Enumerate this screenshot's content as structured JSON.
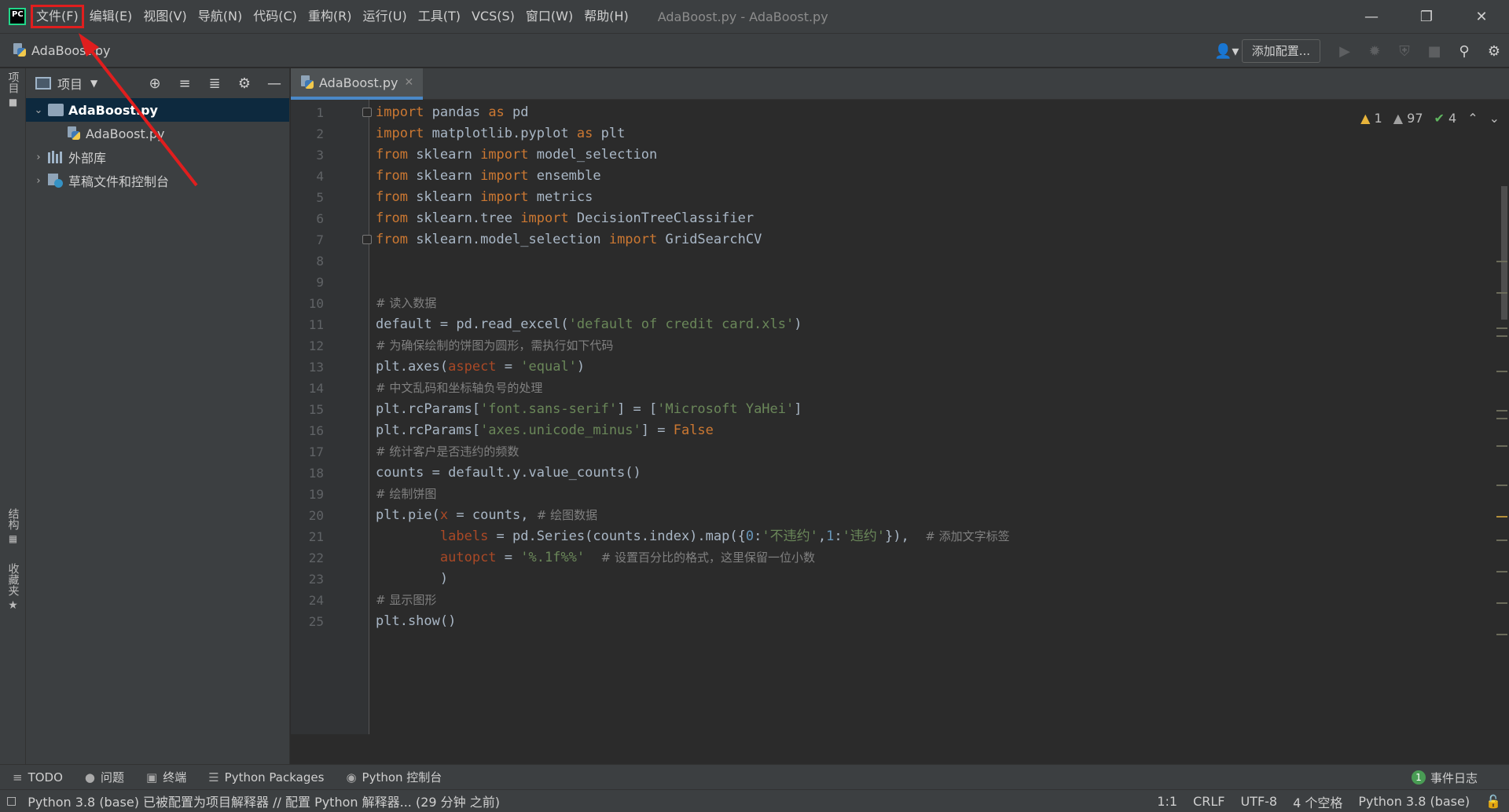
{
  "menu": {
    "items": [
      "文件(F)",
      "编辑(E)",
      "视图(V)",
      "导航(N)",
      "代码(C)",
      "重构(R)",
      "运行(U)",
      "工具(T)",
      "VCS(S)",
      "窗口(W)",
      "帮助(H)"
    ],
    "highlighted_index": 0
  },
  "window": {
    "title": "AdaBoost.py - AdaBoost.py"
  },
  "navbar": {
    "file_label": "AdaBoost.py",
    "run_config_label": "添加配置..."
  },
  "left_strip": {
    "project_label": "项目",
    "structure_label": "结构",
    "favorites_label": "收藏夹"
  },
  "project_panel": {
    "title": "项目",
    "tree": {
      "root_label": "AdaBoost.py",
      "child_label": "AdaBoost.py",
      "external_libs_label": "外部库",
      "scratches_label": "草稿文件和控制台"
    }
  },
  "editor": {
    "tab_label": "AdaBoost.py",
    "inspections": {
      "warnings": "1",
      "weak_warnings": "97",
      "typos": "4"
    },
    "line_numbers": [
      "1",
      "2",
      "3",
      "4",
      "5",
      "6",
      "7",
      "8",
      "9",
      "10",
      "11",
      "12",
      "13",
      "14",
      "15",
      "16",
      "17",
      "18",
      "19",
      "20",
      "21",
      "22",
      "23",
      "24",
      "25"
    ],
    "code": {
      "l1": {
        "kw1": "import",
        "t1": " pandas ",
        "kw2": "as",
        "t2": " pd"
      },
      "l2": {
        "kw1": "import",
        "t1": " matplotlib.pyplot ",
        "kw2": "as",
        "t2": " plt"
      },
      "l3": {
        "kw1": "from",
        "t1": " sklearn ",
        "kw2": "import",
        "t2": " model_selection"
      },
      "l4": {
        "kw1": "from",
        "t1": " sklearn ",
        "kw2": "import",
        "t2": " ensemble"
      },
      "l5": {
        "kw1": "from",
        "t1": " sklearn ",
        "kw2": "import",
        "t2": " metrics"
      },
      "l6": {
        "kw1": "from",
        "t1": " sklearn.tree ",
        "kw2": "import",
        "t2": " DecisionTreeClassifier"
      },
      "l7": {
        "kw1": "from",
        "t1": " sklearn.model_selection ",
        "kw2": "import",
        "t2": " GridSearchCV"
      },
      "l10": {
        "cmt": "# 读入数据"
      },
      "l11": {
        "t1": "default = pd.read_excel(",
        "s1": "'default of credit card.xls'",
        "t2": ")"
      },
      "l12": {
        "cmt": "# 为确保绘制的饼图为圆形，需执行如下代码"
      },
      "l13": {
        "t1": "plt.axes(",
        "p1": "aspect",
        "t2": " = ",
        "s1": "'equal'",
        "t3": ")"
      },
      "l14": {
        "cmt": "# 中文乱码和坐标轴负号的处理"
      },
      "l15": {
        "t1": "plt.rcParams[",
        "s1": "'font.sans-serif'",
        "t2": "] = [",
        "s2": "'Microsoft YaHei'",
        "t3": "]"
      },
      "l16": {
        "t1": "plt.rcParams[",
        "s1": "'axes.unicode_minus'",
        "t2": "] = ",
        "kw1": "False"
      },
      "l17": {
        "cmt": "# 统计客户是否违约的频数"
      },
      "l18": {
        "t1": "counts = default.y.value_counts()"
      },
      "l19": {
        "cmt": "# 绘制饼图"
      },
      "l20": {
        "t1": "plt.pie(",
        "p1": "x",
        "t2": " = counts, ",
        "cmt": "# 绘图数据"
      },
      "l21": {
        "t0": "        ",
        "p1": "labels",
        "t1": " = pd.Series(counts.index).map({",
        "n1": "0",
        "t2": ":",
        "s1": "'不违约'",
        "t3": ",",
        "n2": "1",
        "t4": ":",
        "s2": "'违约'",
        "t5": "}),  ",
        "cmt": "# 添加文字标签"
      },
      "l22": {
        "t0": "        ",
        "p1": "autopct",
        "t1": " = ",
        "s1": "'%.1f%%'",
        "t2": "  ",
        "cmt": "# 设置百分比的格式，这里保留一位小数"
      },
      "l23": {
        "t1": "        )"
      },
      "l24": {
        "cmt": "# 显示图形"
      },
      "l25": {
        "t1": "plt.show()"
      }
    }
  },
  "bottom_tools": {
    "todo": "TODO",
    "problems": "问题",
    "terminal": "终端",
    "packages": "Python Packages",
    "console": "Python 控制台",
    "event_log": "事件日志",
    "event_count": "1"
  },
  "status": {
    "message": "Python 3.8 (base) 已被配置为项目解释器 // 配置 Python 解释器... (29 分钟 之前)",
    "position": "1:1",
    "line_sep": "CRLF",
    "encoding": "UTF-8",
    "indent": "4 个空格",
    "interpreter": "Python 3.8 (base)"
  }
}
